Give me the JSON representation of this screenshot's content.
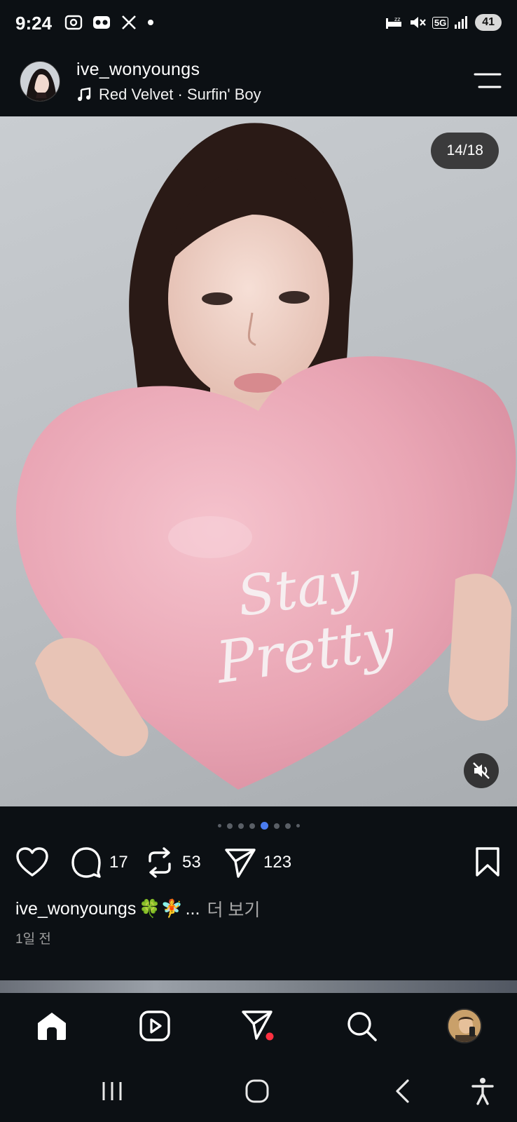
{
  "status_bar": {
    "time": "9:24",
    "network": "5G",
    "battery": "41",
    "left_icons": [
      "screen-record-icon",
      "voicemail-icon",
      "x-app-icon",
      "dot-icon"
    ],
    "right_icons": [
      "sleep-icon",
      "mute-icon",
      "5g-icon",
      "signal-icon",
      "battery-icon"
    ]
  },
  "post": {
    "username": "ive_wonyoungs",
    "music": "Red Velvet · Surfin' Boy",
    "image_counter": "14/18",
    "balloon_text_line1": "Stay",
    "balloon_text_line2": "Pretty",
    "likes_icon": "heart-icon",
    "comments_count": "17",
    "reposts_count": "53",
    "shares_count": "123",
    "caption_username": "ive_wonyoungs",
    "caption_emoji": "🍀🧚",
    "caption_ellipsis": "...",
    "more_label": "더 보기",
    "timestamp": "1일 전",
    "pager": {
      "total_visible": 8,
      "active_index": 4
    }
  },
  "bottom_nav": {
    "items": [
      "home-icon",
      "reels-icon",
      "messages-icon",
      "search-icon",
      "profile-avatar"
    ]
  },
  "system_nav": {
    "items": [
      "recent-apps-icon",
      "home-button-icon",
      "back-icon",
      "accessibility-icon"
    ]
  },
  "colors": {
    "background": "#0c1014",
    "active_dot": "#4a7cf0",
    "notification_dot": "#ff3040",
    "balloon": "#e9a5b4"
  }
}
